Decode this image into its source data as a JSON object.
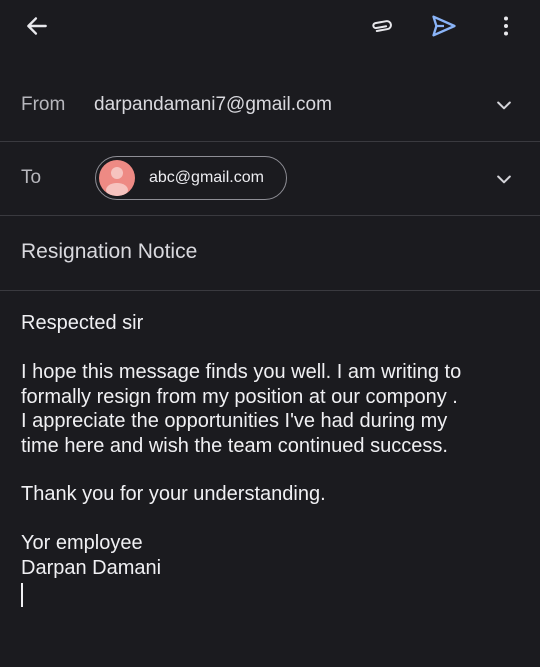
{
  "toolbar": {
    "back_icon": "arrow-left-icon",
    "attach_icon": "paperclip-icon",
    "send_icon": "send-icon",
    "more_icon": "more-vert-icon",
    "send_color": "#8ab4f8"
  },
  "from": {
    "label": "From",
    "value": "darpandamani7@gmail.com"
  },
  "to": {
    "label": "To",
    "recipient": "abc@gmail.com",
    "avatar_color": "#ee8a84"
  },
  "subject": "Resignation Notice",
  "body": {
    "greeting": "Respected sir",
    "paragraph_lines": [
      "I hope this message finds you well. I am writing to",
      "formally resign from my position at our compony .",
      "I appreciate the opportunities I've had during my",
      "time here and wish the team continued success."
    ],
    "thanks": "Thank you for your understanding.",
    "signoff": "Yor employee",
    "name": "Darpan Damani"
  }
}
